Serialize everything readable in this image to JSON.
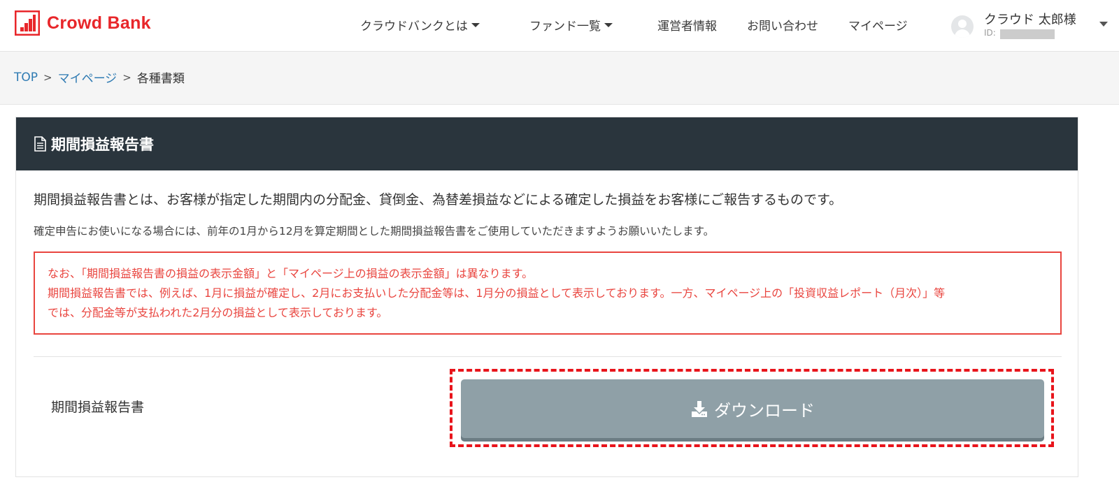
{
  "brand": {
    "name": "Crowd Bank",
    "color": "#e8262a"
  },
  "nav": {
    "about": "クラウドバンクとは",
    "funds": "ファンド一覧",
    "operator": "運営者情報",
    "contact": "お問い合わせ",
    "mypage": "マイページ"
  },
  "user": {
    "name": "クラウド 太郎様",
    "id_label": "ID:"
  },
  "breadcrumb": {
    "top": "TOP",
    "mypage": "マイページ",
    "current": "各種書類"
  },
  "card": {
    "title": "期間損益報告書",
    "description": "期間損益報告書とは、お客様が指定した期間内の分配金、貸倒金、為替差損益などによる確定した損益をお客様にご報告するものです。",
    "note": "確定申告にお使いになる場合には、前年の1月から12月を算定期間とした期間損益報告書をご使用していただきますようお願いいたします。",
    "warning": [
      "なお、「期間損益報告書の損益の表示金額」と「マイページ上の損益の表示金額」は異なります。",
      "期間損益報告書では、例えば、1月に損益が確定し、2月にお支払いした分配金等は、1月分の損益として表示しております。一方、マイページ上の「投資収益レポート（月次）」等",
      "では、分配金等が支払われた2月分の損益として表示しております。"
    ],
    "row_label": "期間損益報告書",
    "download_label": "ダウンロード"
  },
  "colors": {
    "header_dark": "#2a353d",
    "warning_red": "#e9453f",
    "button_gray": "#8fa0a7",
    "link_blue": "#2f7bb3"
  },
  "icons": [
    "logo-icon",
    "chevron-down-icon",
    "user-avatar-icon",
    "document-icon",
    "download-icon"
  ]
}
